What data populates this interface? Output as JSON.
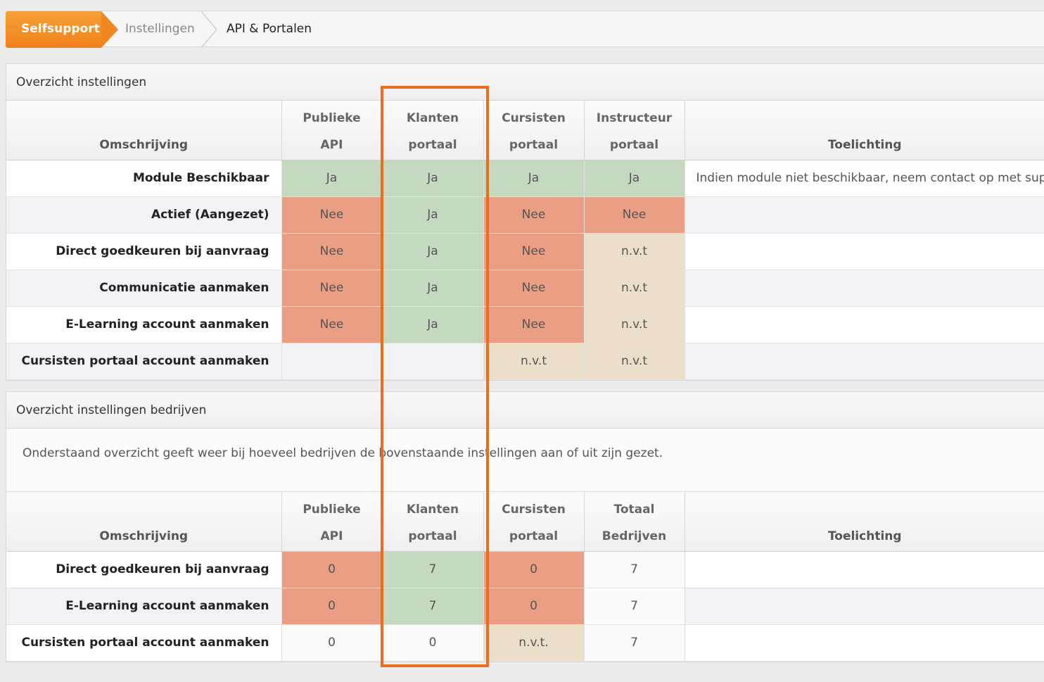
{
  "breadcrumb": {
    "items": [
      "Selfsupport",
      "Instellingen",
      "API & Portalen"
    ]
  },
  "panel1": {
    "title": "Overzicht instellingen",
    "columns": {
      "desc": "Omschrijving",
      "c1": [
        "Publieke",
        "API"
      ],
      "c2": [
        "Klanten",
        "portaal"
      ],
      "c3": [
        "Cursisten",
        "portaal"
      ],
      "c4": [
        "Instructeur",
        "portaal"
      ],
      "note": "Toelichting"
    },
    "rows": [
      {
        "label": "Module Beschikbaar",
        "v": [
          "Ja",
          "Ja",
          "Ja",
          "Ja"
        ],
        "s": [
          "green",
          "green",
          "green",
          "green"
        ],
        "note": "Indien module niet beschikbaar, neem contact op met supp"
      },
      {
        "label": "Actief (Aangezet)",
        "v": [
          "Nee",
          "Ja",
          "Nee",
          "Nee"
        ],
        "s": [
          "red",
          "green",
          "red",
          "red"
        ],
        "note": ""
      },
      {
        "label": "Direct goedkeuren bij aanvraag",
        "v": [
          "Nee",
          "Ja",
          "Nee",
          "n.v.t"
        ],
        "s": [
          "red",
          "green",
          "red",
          "beige"
        ],
        "note": ""
      },
      {
        "label": "Communicatie aanmaken",
        "v": [
          "Nee",
          "Ja",
          "Nee",
          "n.v.t"
        ],
        "s": [
          "red",
          "green",
          "red",
          "beige"
        ],
        "note": ""
      },
      {
        "label": "E-Learning account aanmaken",
        "v": [
          "Nee",
          "Ja",
          "Nee",
          "n.v.t"
        ],
        "s": [
          "red",
          "green",
          "red",
          "beige"
        ],
        "note": ""
      },
      {
        "label": "Cursisten portaal account aanmaken",
        "v": [
          "",
          "",
          "n.v.t",
          "n.v.t"
        ],
        "s": [
          "",
          "",
          "beige",
          "beige"
        ],
        "note": ""
      }
    ]
  },
  "panel2": {
    "title": "Overzicht instellingen bedrijven",
    "intro": "Onderstaand overzicht geeft weer bij hoeveel bedrijven de bovenstaande instellingen aan of uit zijn gezet.",
    "columns": {
      "desc": "Omschrijving",
      "c1": [
        "Publieke",
        "API"
      ],
      "c2": [
        "Klanten",
        "portaal"
      ],
      "c3": [
        "Cursisten",
        "portaal"
      ],
      "c4": [
        "Totaal",
        "Bedrijven"
      ],
      "note": "Toelichting"
    },
    "rows": [
      {
        "label": "Direct goedkeuren bij aanvraag",
        "v": [
          "0",
          "7",
          "0",
          "7"
        ],
        "s": [
          "red",
          "green",
          "red",
          "total"
        ],
        "note": ""
      },
      {
        "label": "E-Learning account aanmaken",
        "v": [
          "0",
          "7",
          "0",
          "7"
        ],
        "s": [
          "red",
          "green",
          "red",
          "total"
        ],
        "note": ""
      },
      {
        "label": "Cursisten portaal account aanmaken",
        "v": [
          "0",
          "0",
          "n.v.t.",
          "7"
        ],
        "s": [
          "plain",
          "plain",
          "beige",
          "total"
        ],
        "note": ""
      }
    ]
  },
  "colors": {
    "accent": "#ef7f1a",
    "highlight": "#ea6e1e",
    "yes": "#c5d8c0",
    "no": "#ea9f85",
    "na": "#ecdfca"
  }
}
